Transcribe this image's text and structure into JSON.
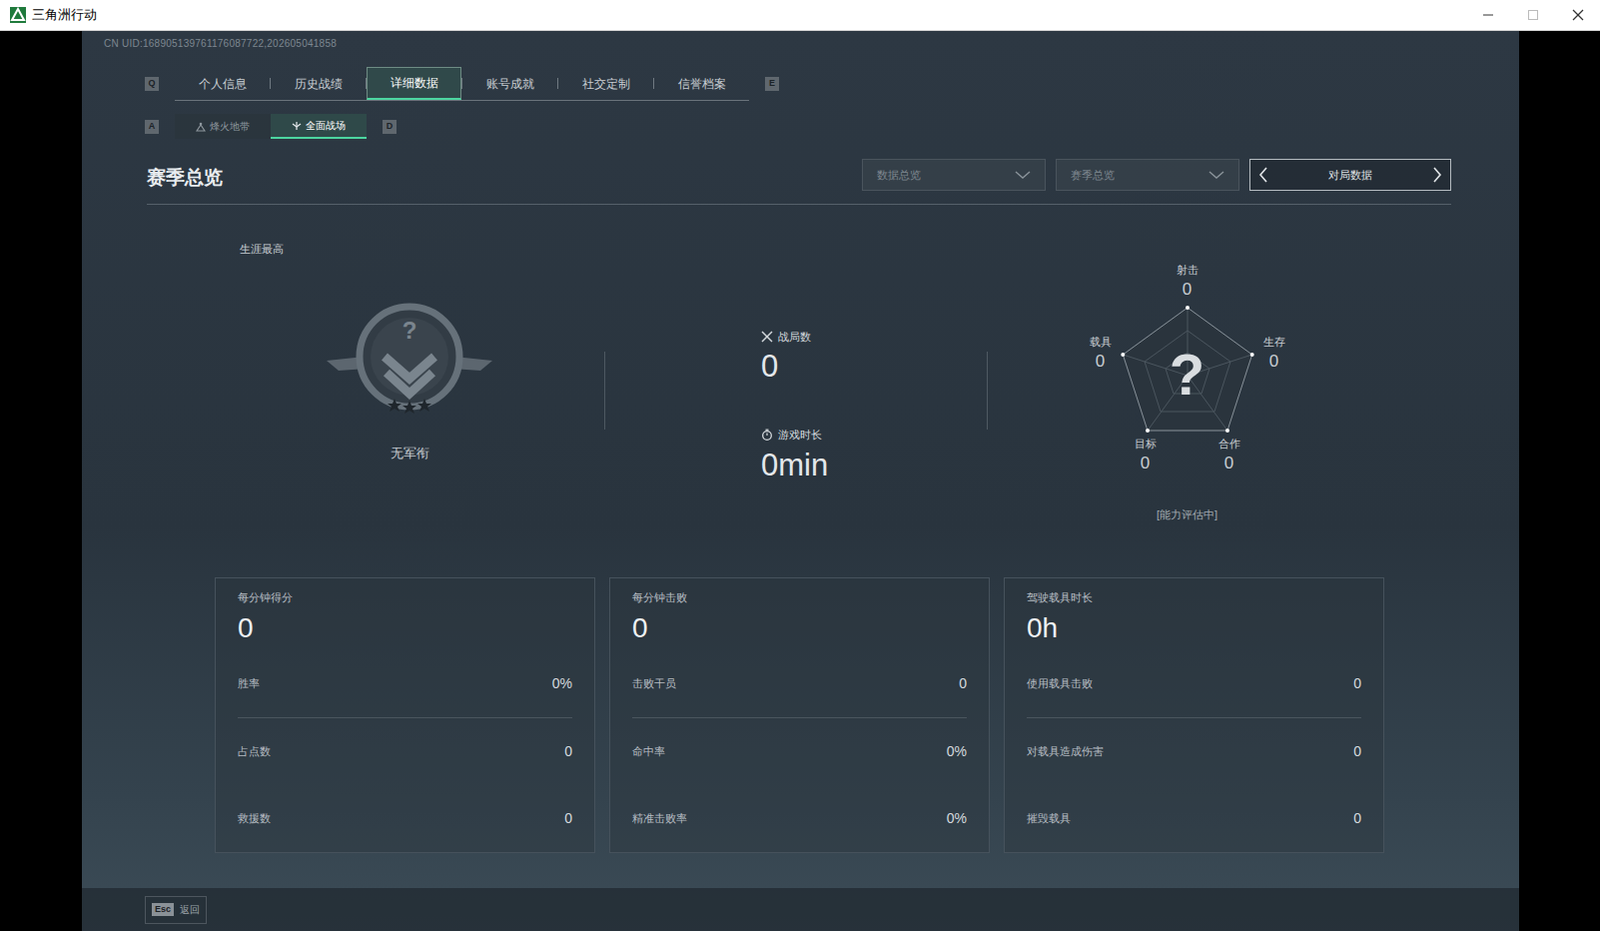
{
  "window": {
    "title": "三角洲行动"
  },
  "uid": "CN UID:168905139761176087722,202605041858",
  "tabs": {
    "prev_key": "Q",
    "next_key": "E",
    "items": [
      {
        "label": "个人信息",
        "selected": false
      },
      {
        "label": "历史战绩",
        "selected": false
      },
      {
        "label": "详细数据",
        "selected": true
      },
      {
        "label": "账号成就",
        "selected": false
      },
      {
        "label": "社交定制",
        "selected": false
      },
      {
        "label": "信誉档案",
        "selected": false
      }
    ]
  },
  "sub_tabs": {
    "prev_key": "A",
    "next_key": "D",
    "items": [
      {
        "label": "烽火地带",
        "selected": false
      },
      {
        "label": "全面战场",
        "selected": true
      }
    ]
  },
  "section_title": "赛季总览",
  "filters": [
    {
      "label": "数据总览",
      "kind": "dropdown"
    },
    {
      "label": "赛季总览",
      "kind": "dropdown"
    },
    {
      "label": "对局数据",
      "kind": "stepper"
    }
  ],
  "career": {
    "label": "生涯最高",
    "rank_symbol": "?",
    "rank": "无军衔"
  },
  "summary": [
    {
      "label": "战局数",
      "value": "0"
    },
    {
      "label": "游戏时长",
      "value": "0min"
    }
  ],
  "radar": {
    "center": "?",
    "axes": [
      {
        "label": "射击",
        "value": "0"
      },
      {
        "label": "生存",
        "value": "0"
      },
      {
        "label": "合作",
        "value": "0"
      },
      {
        "label": "目标",
        "value": "0"
      },
      {
        "label": "载具",
        "value": "0"
      }
    ],
    "status": "[能力评估中]"
  },
  "cards": [
    {
      "title": "每分钟得分",
      "value": "0",
      "rows": [
        {
          "label": "胜率",
          "value": "0%"
        },
        {
          "label": "占点数",
          "value": "0"
        },
        {
          "label": "救援数",
          "value": "0"
        }
      ]
    },
    {
      "title": "每分钟击败",
      "value": "0",
      "rows": [
        {
          "label": "击败干员",
          "value": "0"
        },
        {
          "label": "命中率",
          "value": "0%"
        },
        {
          "label": "精准击败率",
          "value": "0%"
        }
      ]
    },
    {
      "title": "驾驶载具时长",
      "value": "0h",
      "rows": [
        {
          "label": "使用载具击败",
          "value": "0"
        },
        {
          "label": "对载具造成伤害",
          "value": "0"
        },
        {
          "label": "摧毁载具",
          "value": "0"
        }
      ]
    }
  ],
  "footer": {
    "key": "Esc",
    "label": "返回"
  }
}
